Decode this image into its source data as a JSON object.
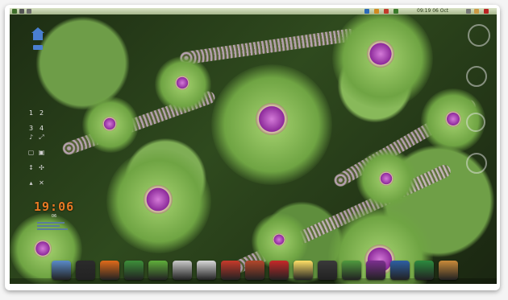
{
  "desktop": {
    "clock_time": "19:06",
    "clock_sub": "06",
    "top_clock_text": "09:19 06 Oct"
  },
  "workspaces": [
    "1",
    "2",
    "3",
    "4"
  ],
  "colors": {
    "clock": "#e87a24",
    "home_icon": "#4a7fd0"
  },
  "dock": {
    "icons": [
      {
        "name": "photo-viewer-icon",
        "color": "#5a8bc8"
      },
      {
        "name": "terminal-icon",
        "color": "#2b2b2b"
      },
      {
        "name": "firefox-icon",
        "color": "#e06a1a"
      },
      {
        "name": "browser-icon",
        "color": "#3d8f3a"
      },
      {
        "name": "settings-gear-icon",
        "color": "#5fae3b"
      },
      {
        "name": "text-editor-icon",
        "color": "#c9c9c9"
      },
      {
        "name": "notes-icon",
        "color": "#d8d8d8"
      },
      {
        "name": "media-player-icon",
        "color": "#c73a2a"
      },
      {
        "name": "paint-icon",
        "color": "#b3472b"
      },
      {
        "name": "office-icon",
        "color": "#c62828"
      },
      {
        "name": "package-icon",
        "color": "#ffe066"
      },
      {
        "name": "monitor-icon",
        "color": "#3a3a3a"
      },
      {
        "name": "image-icon",
        "color": "#4f9a3e"
      },
      {
        "name": "music-icon",
        "color": "#7b2f8f"
      },
      {
        "name": "games-icon",
        "color": "#2e5fa3"
      },
      {
        "name": "file-manager-icon",
        "color": "#2c8a3e"
      },
      {
        "name": "archive-icon",
        "color": "#c88a3a"
      }
    ]
  }
}
